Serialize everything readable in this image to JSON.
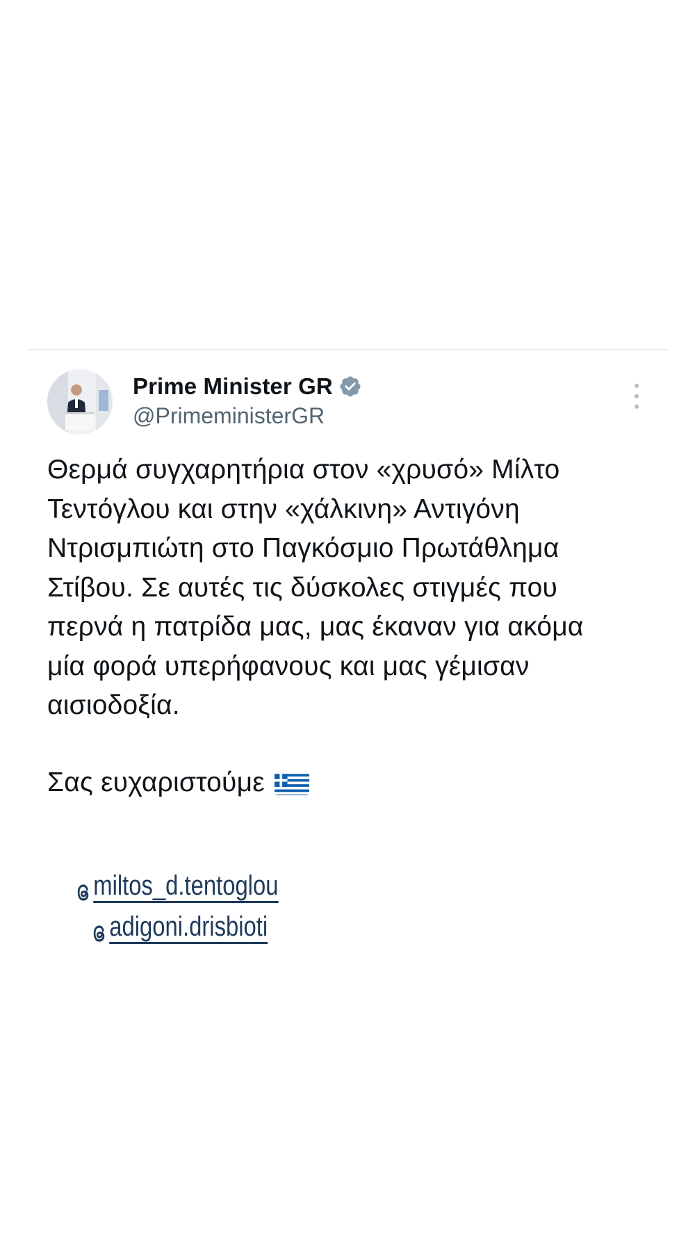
{
  "post": {
    "author": {
      "display_name": "Prime Minister GR",
      "handle": "@PrimeministerGR",
      "verified": true,
      "verified_icon": "verified-badge-icon",
      "avatar_icon": "profile-photo"
    },
    "more_icon": "more-vertical-icon",
    "text": "Θερμά συγχαρητήρια στον «χρυσό» Μίλτο\nΤεντόγλου και στην «χάλκινη» Αντιγόνη\nΝτρισμπιώτη στο Παγκόσμιο Πρωτάθλημα\nΣτίβου. Σε αυτές τις δύσκολες στιγμές που\nπερνά η πατρίδα μας, μας έκαναν για ακόμα\nμία φορά υπερήφανους και μας γέμισαν\nαισιοδοξία.",
    "closing": "Σας ευχαριστούμε",
    "closing_emoji": "greek-flag-icon"
  },
  "mentions": [
    {
      "text": "miltos_d.tentoglou",
      "icon": "threads-icon"
    },
    {
      "text": "adigoni.drisbioti",
      "icon": "threads-icon"
    }
  ],
  "colors": {
    "background": "#ffffff",
    "text": "#0f1419",
    "handle": "#536471",
    "verified_badge": "#829aab",
    "mention": "#1e3a5c",
    "greek_blue": "#0d5eaf"
  }
}
